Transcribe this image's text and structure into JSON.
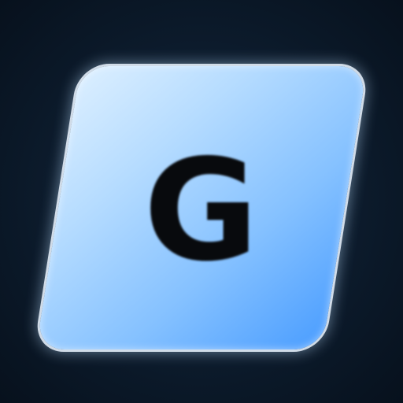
{
  "icon": {
    "letter": "G",
    "name": "g-letter-app-icon",
    "colors": {
      "background": "#0b1a2b",
      "tile_light": "#dcefff",
      "tile_dark": "#4a9dff",
      "letter": "#080a0d"
    }
  }
}
